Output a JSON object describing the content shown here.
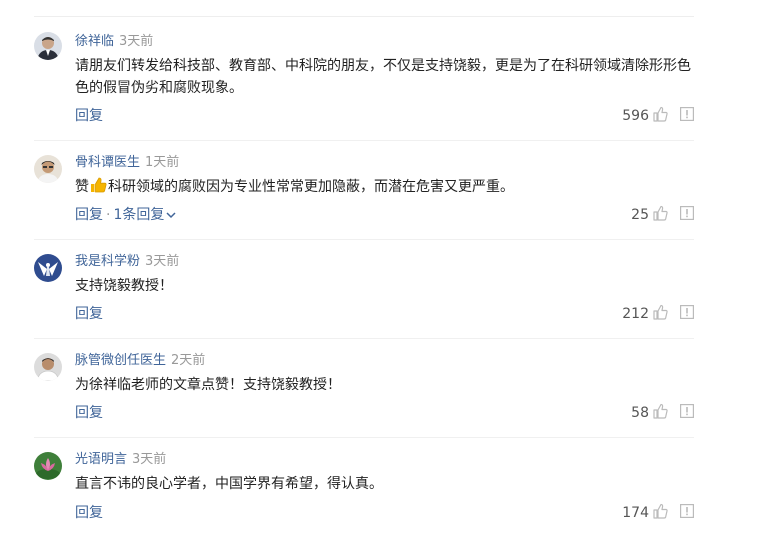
{
  "colors": {
    "author": "#406599",
    "time": "#999999",
    "text": "#222222",
    "count": "#555555",
    "icon": "#bbbbbb",
    "emoji": "#f5b400"
  },
  "comments": [
    {
      "author": "徐祥临",
      "time": "3天前",
      "text": "请朋友们转发给科技部、教育部、中科院的朋友，不仅是支持饶毅，更是为了在科研领域清除形形色色的假冒伪劣和腐败现象。",
      "reply_label": "回复",
      "likes": "596",
      "avatar_icon": "portrait-icon"
    },
    {
      "author": "骨科谭医生",
      "time": "1天前",
      "text_prefix": "赞",
      "emoji_icon": "thumbs-up-emoji-icon",
      "text": "科研领域的腐败因为专业性常常更加隐蔽，而潜在危害又更严重。",
      "reply_label": "回复",
      "replies_count_label": "1条回复",
      "likes": "25",
      "avatar_icon": "portrait-icon"
    },
    {
      "author": "我是科学粉",
      "time": "3天前",
      "text": "支持饶毅教授！",
      "reply_label": "回复",
      "likes": "212",
      "avatar_icon": "eagle-icon"
    },
    {
      "author": "脉管微创任医生",
      "time": "2天前",
      "text": "为徐祥临老师的文章点赞！支持饶毅教授！",
      "reply_label": "回复",
      "likes": "58",
      "avatar_icon": "portrait-icon"
    },
    {
      "author": "光语明言",
      "time": "3天前",
      "text": "直言不讳的良心学者，中国学界有希望，得认真。",
      "reply_label": "回复",
      "likes": "174",
      "avatar_icon": "lotus-icon"
    }
  ]
}
